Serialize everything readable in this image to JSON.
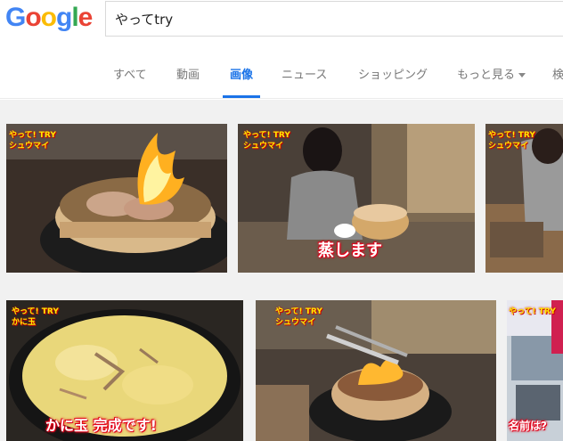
{
  "logo": {
    "letters": [
      "G",
      "o",
      "o",
      "g",
      "l",
      "e"
    ],
    "colors": [
      "#4285F4",
      "#EA4335",
      "#FBBC05",
      "#4285F4",
      "#34A853",
      "#EA4335"
    ]
  },
  "search": {
    "value": "やってtry"
  },
  "tabs": [
    {
      "label": "すべて"
    },
    {
      "label": "動画"
    },
    {
      "label": "画像",
      "active": true
    },
    {
      "label": "ニュース"
    },
    {
      "label": "ショッピング"
    },
    {
      "label": "もっと見る"
    },
    {
      "label": "検"
    }
  ],
  "images": [
    {
      "badge": "やって! TRY",
      "sub": "シュウマイ",
      "caption": ""
    },
    {
      "badge": "やって! TRY",
      "sub": "シュウマイ",
      "caption": "蒸します"
    },
    {
      "badge": "やって! TRY",
      "sub": "シュウマイ",
      "caption": ""
    },
    {
      "badge": "やって! TRY",
      "sub": "かに玉",
      "caption": "かに玉 完成です!"
    },
    {
      "badge": "やって! TRY",
      "sub": "シュウマイ",
      "caption": ""
    },
    {
      "badge": "やって! TRY",
      "sub": "",
      "caption": "名前は?"
    }
  ],
  "colors": {
    "accent": "#1a73e8",
    "caption_red": "#e2001a"
  }
}
